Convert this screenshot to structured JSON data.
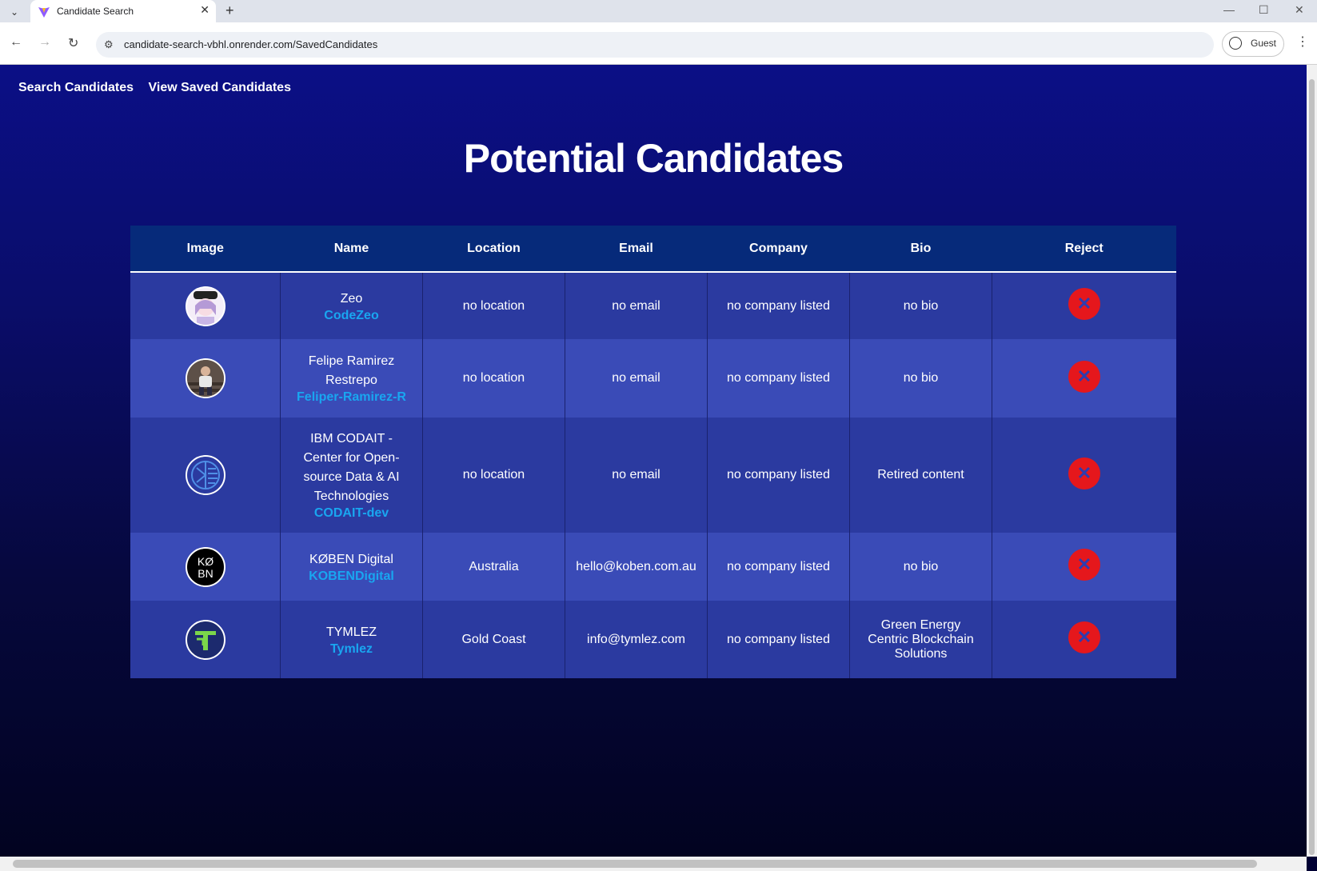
{
  "browser": {
    "tab_title": "Candidate Search",
    "url": "candidate-search-vbhl.onrender.com/SavedCandidates",
    "profile_label": "Guest"
  },
  "nav": {
    "search_label": "Search Candidates",
    "saved_label": "View Saved Candidates"
  },
  "page_title": "Potential Candidates",
  "table": {
    "headers": [
      "Image",
      "Name",
      "Location",
      "Email",
      "Company",
      "Bio",
      "Reject"
    ],
    "rows": [
      {
        "name": "Zeo",
        "login": "CodeZeo",
        "location": "no location",
        "email": "no email",
        "company": "no company listed",
        "bio": "no bio",
        "avatar_icon": "anime-avatar-icon"
      },
      {
        "name": "Felipe Ramirez Restrepo",
        "login": "Feliper-Ramirez-R",
        "location": "no location",
        "email": "no email",
        "company": "no company listed",
        "bio": "no bio",
        "avatar_icon": "person-photo-avatar-icon"
      },
      {
        "name": "IBM CODAIT - Center for Open-source Data & AI Technologies",
        "login": "CODAIT-dev",
        "location": "no location",
        "email": "no email",
        "company": "no company listed",
        "bio": "Retired content",
        "avatar_icon": "codait-logo-icon"
      },
      {
        "name": "KØBEN Digital",
        "login": "KOBENDigital",
        "location": "Australia",
        "email": "hello@koben.com.au",
        "company": "no company listed",
        "bio": "no bio",
        "avatar_icon": "koben-logo-icon",
        "logo_text": "KØ BN"
      },
      {
        "name": "TYMLEZ",
        "login": "Tymlez",
        "location": "Gold Coast",
        "email": "info@tymlez.com",
        "company": "no company listed",
        "bio": "Green Energy Centric Blockchain Solutions",
        "avatar_icon": "tymlez-logo-icon"
      }
    ],
    "reject_glyph": "✕"
  },
  "colors": {
    "accent_link": "#19a6f0",
    "reject_red": "#e5171c",
    "header_bg": "#062a7a"
  }
}
